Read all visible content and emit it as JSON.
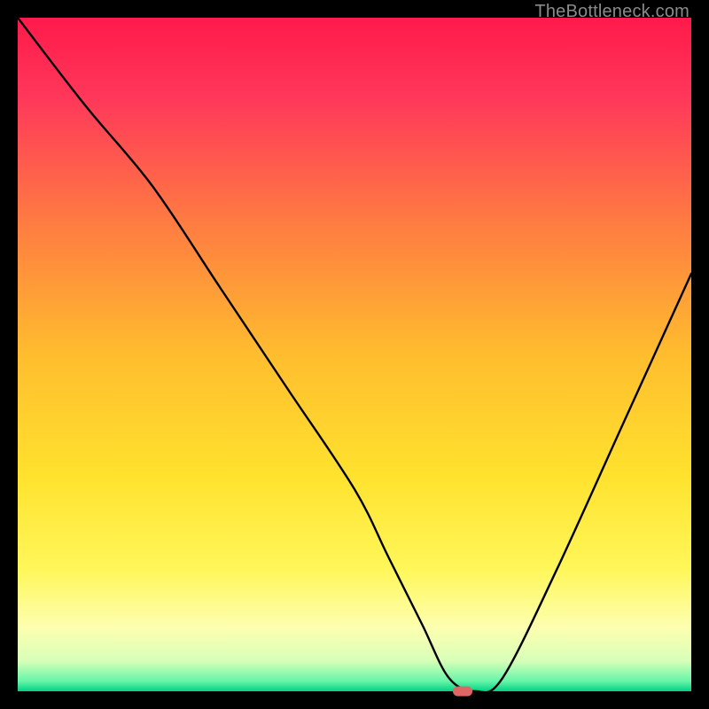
{
  "watermark": {
    "text": "TheBottleneck.com"
  },
  "chart_data": {
    "type": "line",
    "title": "",
    "xlabel": "",
    "ylabel": "",
    "xlim": [
      0,
      100
    ],
    "ylim": [
      0,
      100
    ],
    "grid": false,
    "legend": null,
    "series": [
      {
        "name": "bottleneck-curve",
        "x": [
          0,
          10,
          20,
          30,
          40,
          50,
          55,
          60,
          64,
          68,
          72,
          80,
          90,
          100
        ],
        "y": [
          100,
          87,
          75,
          60,
          45,
          30,
          20,
          10,
          2,
          0,
          2,
          18,
          40,
          62
        ]
      }
    ],
    "marker": {
      "x": 66,
      "y": 0,
      "color": "#e06666"
    },
    "gradient_stops": [
      {
        "offset": 0.0,
        "color": "#ff1a4b"
      },
      {
        "offset": 0.12,
        "color": "#ff385a"
      },
      {
        "offset": 0.3,
        "color": "#ff7a42"
      },
      {
        "offset": 0.5,
        "color": "#ffbd2e"
      },
      {
        "offset": 0.68,
        "color": "#ffe22e"
      },
      {
        "offset": 0.82,
        "color": "#fff75a"
      },
      {
        "offset": 0.905,
        "color": "#fdffb0"
      },
      {
        "offset": 0.955,
        "color": "#d8ffb8"
      },
      {
        "offset": 0.985,
        "color": "#66f5a8"
      },
      {
        "offset": 1.0,
        "color": "#00d084"
      }
    ]
  }
}
